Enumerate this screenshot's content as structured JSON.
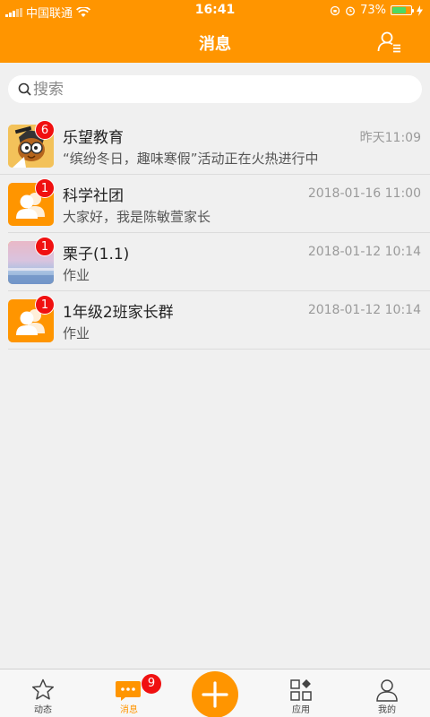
{
  "status_bar": {
    "carrier": "中国联通",
    "time": "16:41",
    "battery": "73%",
    "battery_level": 0.73
  },
  "nav": {
    "title": "消息",
    "contacts_icon": "contacts-icon"
  },
  "search": {
    "placeholder": "搜索",
    "value": ""
  },
  "conversations": [
    {
      "name": "乐望教育",
      "preview": "“缤纷冬日，趣味寒假”活动正在火热进行中",
      "time": "昨天11:09",
      "badge": "6",
      "avatar": "cartoon-avatar"
    },
    {
      "name": "科学社团",
      "preview": "大家好，我是陈敏萱家长",
      "time": "2018-01-16 11:00",
      "badge": "1",
      "avatar": "group-icon"
    },
    {
      "name": "栗子(1.1)",
      "preview": "作业",
      "time": "2018-01-12 10:14",
      "badge": "1",
      "avatar": "photo-avatar"
    },
    {
      "name": "1年级2班家长群",
      "preview": "作业",
      "time": "2018-01-12 10:14",
      "badge": "1",
      "avatar": "group-icon"
    }
  ],
  "tabs": [
    {
      "label": "动态",
      "icon": "star-icon"
    },
    {
      "label": "消息",
      "icon": "chat-icon",
      "badge": "9",
      "active": true
    },
    {
      "label": "",
      "icon": "plus-icon"
    },
    {
      "label": "应用",
      "icon": "apps-icon"
    },
    {
      "label": "我的",
      "icon": "profile-icon"
    }
  ],
  "colors": {
    "accent": "#ff9500",
    "badge": "#f01010"
  }
}
